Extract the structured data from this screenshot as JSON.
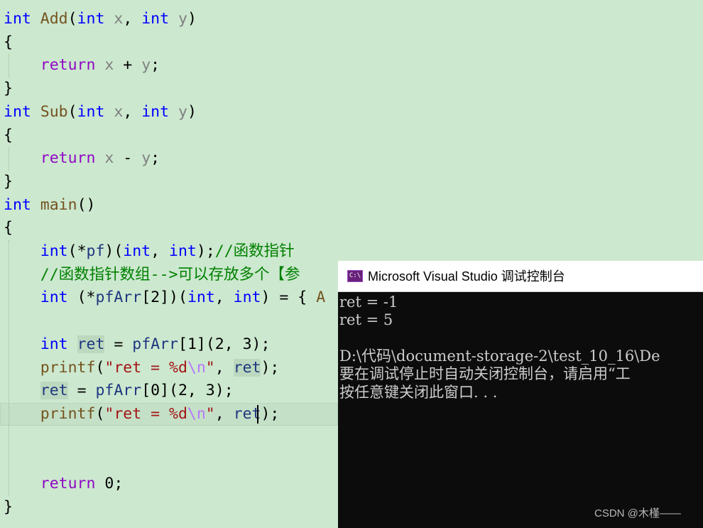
{
  "editor": {
    "lines": [
      [
        [
          "kw",
          "int"
        ],
        [
          "pun",
          " "
        ],
        [
          "fn",
          "Add"
        ],
        [
          "pun",
          "("
        ],
        [
          "kw",
          "int"
        ],
        [
          "pun",
          " "
        ],
        [
          "prm",
          "x"
        ],
        [
          "pun",
          ", "
        ],
        [
          "kw",
          "int"
        ],
        [
          "pun",
          " "
        ],
        [
          "prm",
          "y"
        ],
        [
          "pun",
          ")"
        ]
      ],
      [
        [
          "pun",
          "{"
        ]
      ],
      [
        [
          "pun",
          "    "
        ],
        [
          "ctl",
          "return"
        ],
        [
          "pun",
          " "
        ],
        [
          "prm",
          "x"
        ],
        [
          "pun",
          " + "
        ],
        [
          "prm",
          "y"
        ],
        [
          "pun",
          ";"
        ]
      ],
      [
        [
          "pun",
          "}"
        ]
      ],
      [
        [
          "kw",
          "int"
        ],
        [
          "pun",
          " "
        ],
        [
          "fn",
          "Sub"
        ],
        [
          "pun",
          "("
        ],
        [
          "kw",
          "int"
        ],
        [
          "pun",
          " "
        ],
        [
          "prm",
          "x"
        ],
        [
          "pun",
          ", "
        ],
        [
          "kw",
          "int"
        ],
        [
          "pun",
          " "
        ],
        [
          "prm",
          "y"
        ],
        [
          "pun",
          ")"
        ]
      ],
      [
        [
          "pun",
          "{"
        ]
      ],
      [
        [
          "pun",
          "    "
        ],
        [
          "ctl",
          "return"
        ],
        [
          "pun",
          " "
        ],
        [
          "prm",
          "x"
        ],
        [
          "pun",
          " - "
        ],
        [
          "prm",
          "y"
        ],
        [
          "pun",
          ";"
        ]
      ],
      [
        [
          "pun",
          "}"
        ]
      ],
      [
        [
          "kw",
          "int"
        ],
        [
          "pun",
          " "
        ],
        [
          "fn",
          "main"
        ],
        [
          "pun",
          "()"
        ]
      ],
      [
        [
          "pun",
          "{"
        ]
      ],
      [
        [
          "pun",
          "    "
        ],
        [
          "kw",
          "int"
        ],
        [
          "pun",
          "(*"
        ],
        [
          "var",
          "pf"
        ],
        [
          "pun",
          ")("
        ],
        [
          "kw",
          "int"
        ],
        [
          "pun",
          ", "
        ],
        [
          "kw",
          "int"
        ],
        [
          "pun",
          ");"
        ],
        [
          "cm",
          "//函数指针"
        ]
      ],
      [
        [
          "pun",
          "    "
        ],
        [
          "cm",
          "//函数指针数组-->可以存放多个【参"
        ]
      ],
      [
        [
          "pun",
          "    "
        ],
        [
          "kw",
          "int"
        ],
        [
          "pun",
          " (*"
        ],
        [
          "var",
          "pfArr"
        ],
        [
          "pun",
          "[2])("
        ],
        [
          "kw",
          "int"
        ],
        [
          "pun",
          ", "
        ],
        [
          "kw",
          "int"
        ],
        [
          "pun",
          ") = { "
        ],
        [
          "fn",
          "A"
        ]
      ],
      [],
      [
        [
          "pun",
          "    "
        ],
        [
          "kw",
          "int"
        ],
        [
          "pun",
          " "
        ],
        [
          "var",
          "ret"
        ],
        [
          "pun",
          " = "
        ],
        [
          "var",
          "pfArr"
        ],
        [
          "pun",
          "[1](2, 3);"
        ]
      ],
      [
        [
          "pun",
          "    "
        ],
        [
          "fn",
          "printf"
        ],
        [
          "pun",
          "("
        ],
        [
          "str",
          "\"ret = %d"
        ],
        [
          "esc",
          "\\n"
        ],
        [
          "str",
          "\""
        ],
        [
          "pun",
          ", "
        ],
        [
          "var",
          "ret"
        ],
        [
          "pun",
          ");"
        ]
      ],
      [
        [
          "pun",
          "    "
        ],
        [
          "var",
          "ret"
        ],
        [
          "pun",
          " = "
        ],
        [
          "var",
          "pfArr"
        ],
        [
          "pun",
          "[0](2, 3);"
        ]
      ],
      [
        [
          "pun",
          "    "
        ],
        [
          "fn",
          "printf"
        ],
        [
          "pun",
          "("
        ],
        [
          "str",
          "\"ret = %d"
        ],
        [
          "esc",
          "\\n"
        ],
        [
          "str",
          "\""
        ],
        [
          "pun",
          ", "
        ],
        [
          "var",
          "ret"
        ],
        [
          "pun",
          ");"
        ]
      ],
      [],
      [],
      [
        [
          "pun",
          "    "
        ],
        [
          "ctl",
          "return"
        ],
        [
          "pun",
          " 0;"
        ]
      ],
      [
        [
          "pun",
          "}"
        ]
      ]
    ]
  },
  "console": {
    "title": "Microsoft Visual Studio 调试控制台",
    "icon": "console-app-icon",
    "icon_text": "C:\\",
    "output": [
      "ret = -1",
      "ret = 5",
      "",
      "D:\\代码\\document-storage-2\\test_10_16\\De",
      "要在调试停止时自动关闭控制台，请启用“工",
      "按任意键关闭此窗口. . ."
    ]
  },
  "watermark": "CSDN @木槿——"
}
